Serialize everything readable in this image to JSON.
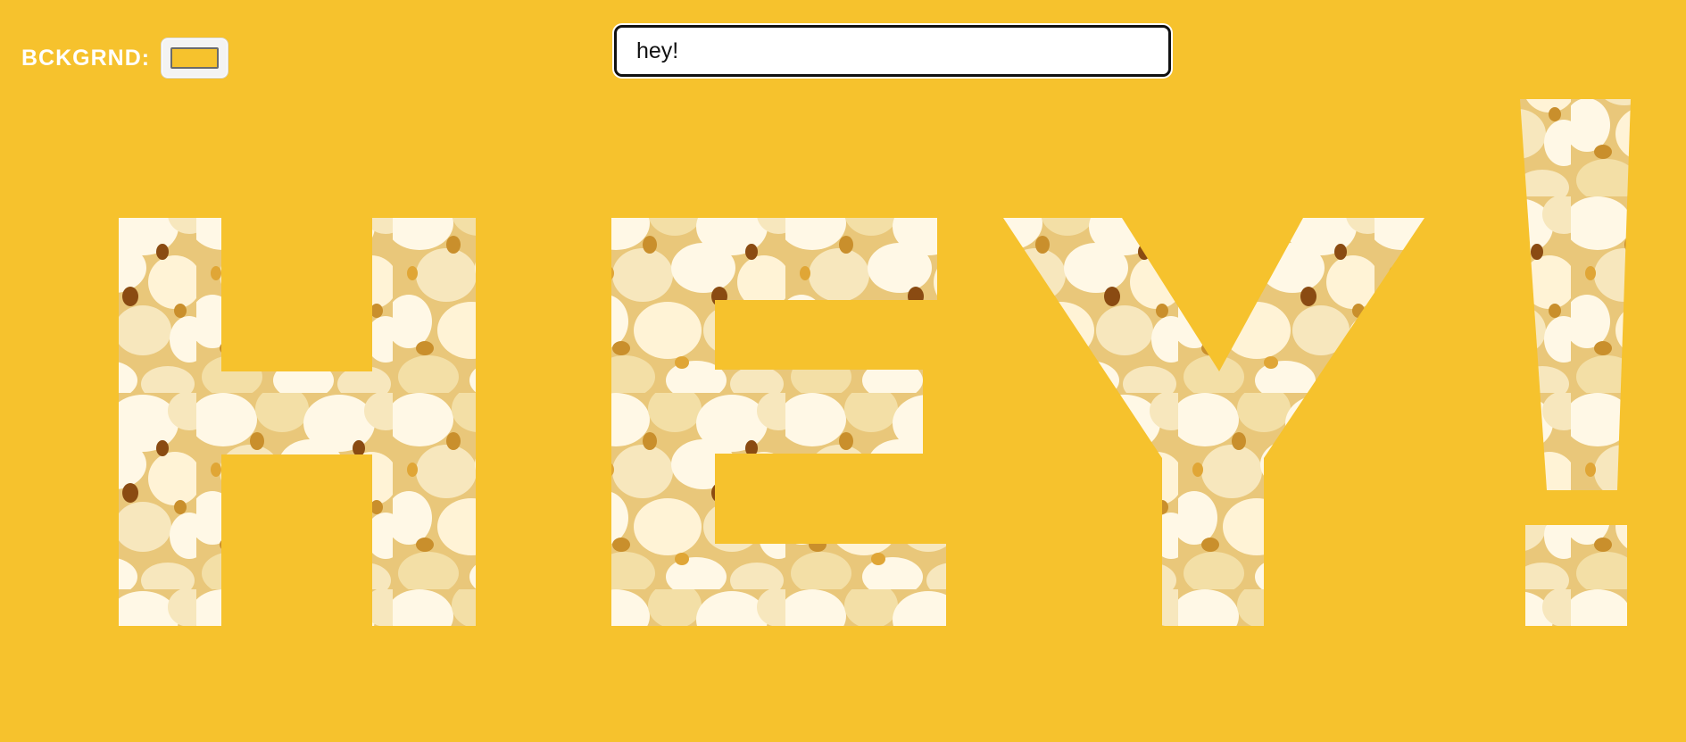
{
  "background_control": {
    "label": "BCKGRND:",
    "color": "#F6C22D"
  },
  "text_input": {
    "value": "hey!"
  },
  "display": {
    "characters": [
      "H",
      "E",
      "Y",
      "!"
    ],
    "fill_texture": "popcorn"
  },
  "colors": {
    "background": "#F6C22D",
    "label_text": "#FFFFFF",
    "input_border": "#111111",
    "popcorn_white": "#FFF8E6",
    "popcorn_cream": "#F3DFA6",
    "popcorn_shadow": "#C98F2C",
    "popcorn_kernel": "#8A4B12"
  }
}
